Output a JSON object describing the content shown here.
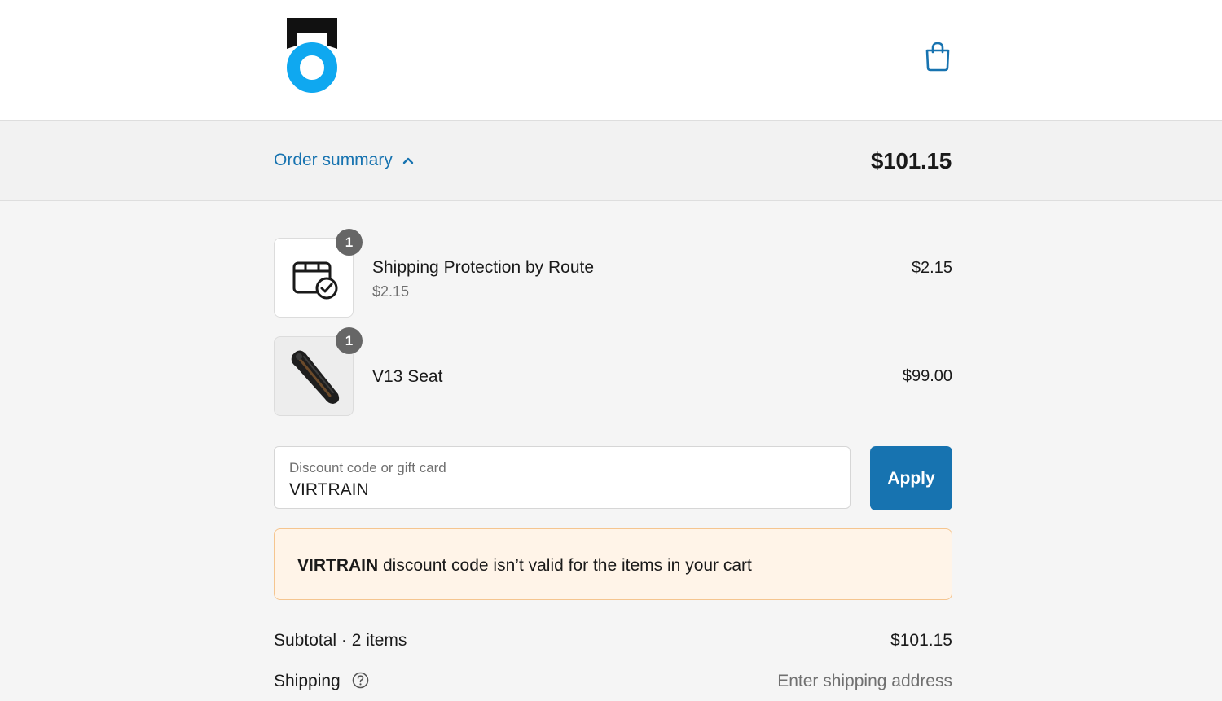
{
  "header": {
    "logo_icon": "brand-logo",
    "cart_icon": "shopping-bag-icon"
  },
  "summary": {
    "toggle_label": "Order summary",
    "toggle_icon": "chevron-up-icon",
    "total": "$101.15"
  },
  "items": [
    {
      "quantity": "1",
      "name": "Shipping Protection by Route",
      "unit_price": "$2.15",
      "price": "$2.15",
      "image_icon": "package-check-icon"
    },
    {
      "quantity": "1",
      "name": "V13 Seat",
      "price": "$99.00",
      "image_icon": "bike-seat-image"
    }
  ],
  "discount": {
    "label": "Discount code or gift card",
    "value": "VIRTRAIN",
    "apply_label": "Apply"
  },
  "notice": {
    "code": "VIRTRAIN",
    "message": " discount code isn’t valid for the items in your cart"
  },
  "totals": {
    "subtotal_label": "Subtotal · 2 items",
    "subtotal_value": "$101.15",
    "shipping_label": "Shipping",
    "shipping_value": "Enter shipping address"
  },
  "colors": {
    "accent": "#1773b0",
    "logo_blue": "#0fa8f0",
    "notice_bg": "#fff4e8",
    "notice_border": "#f5c58f"
  }
}
